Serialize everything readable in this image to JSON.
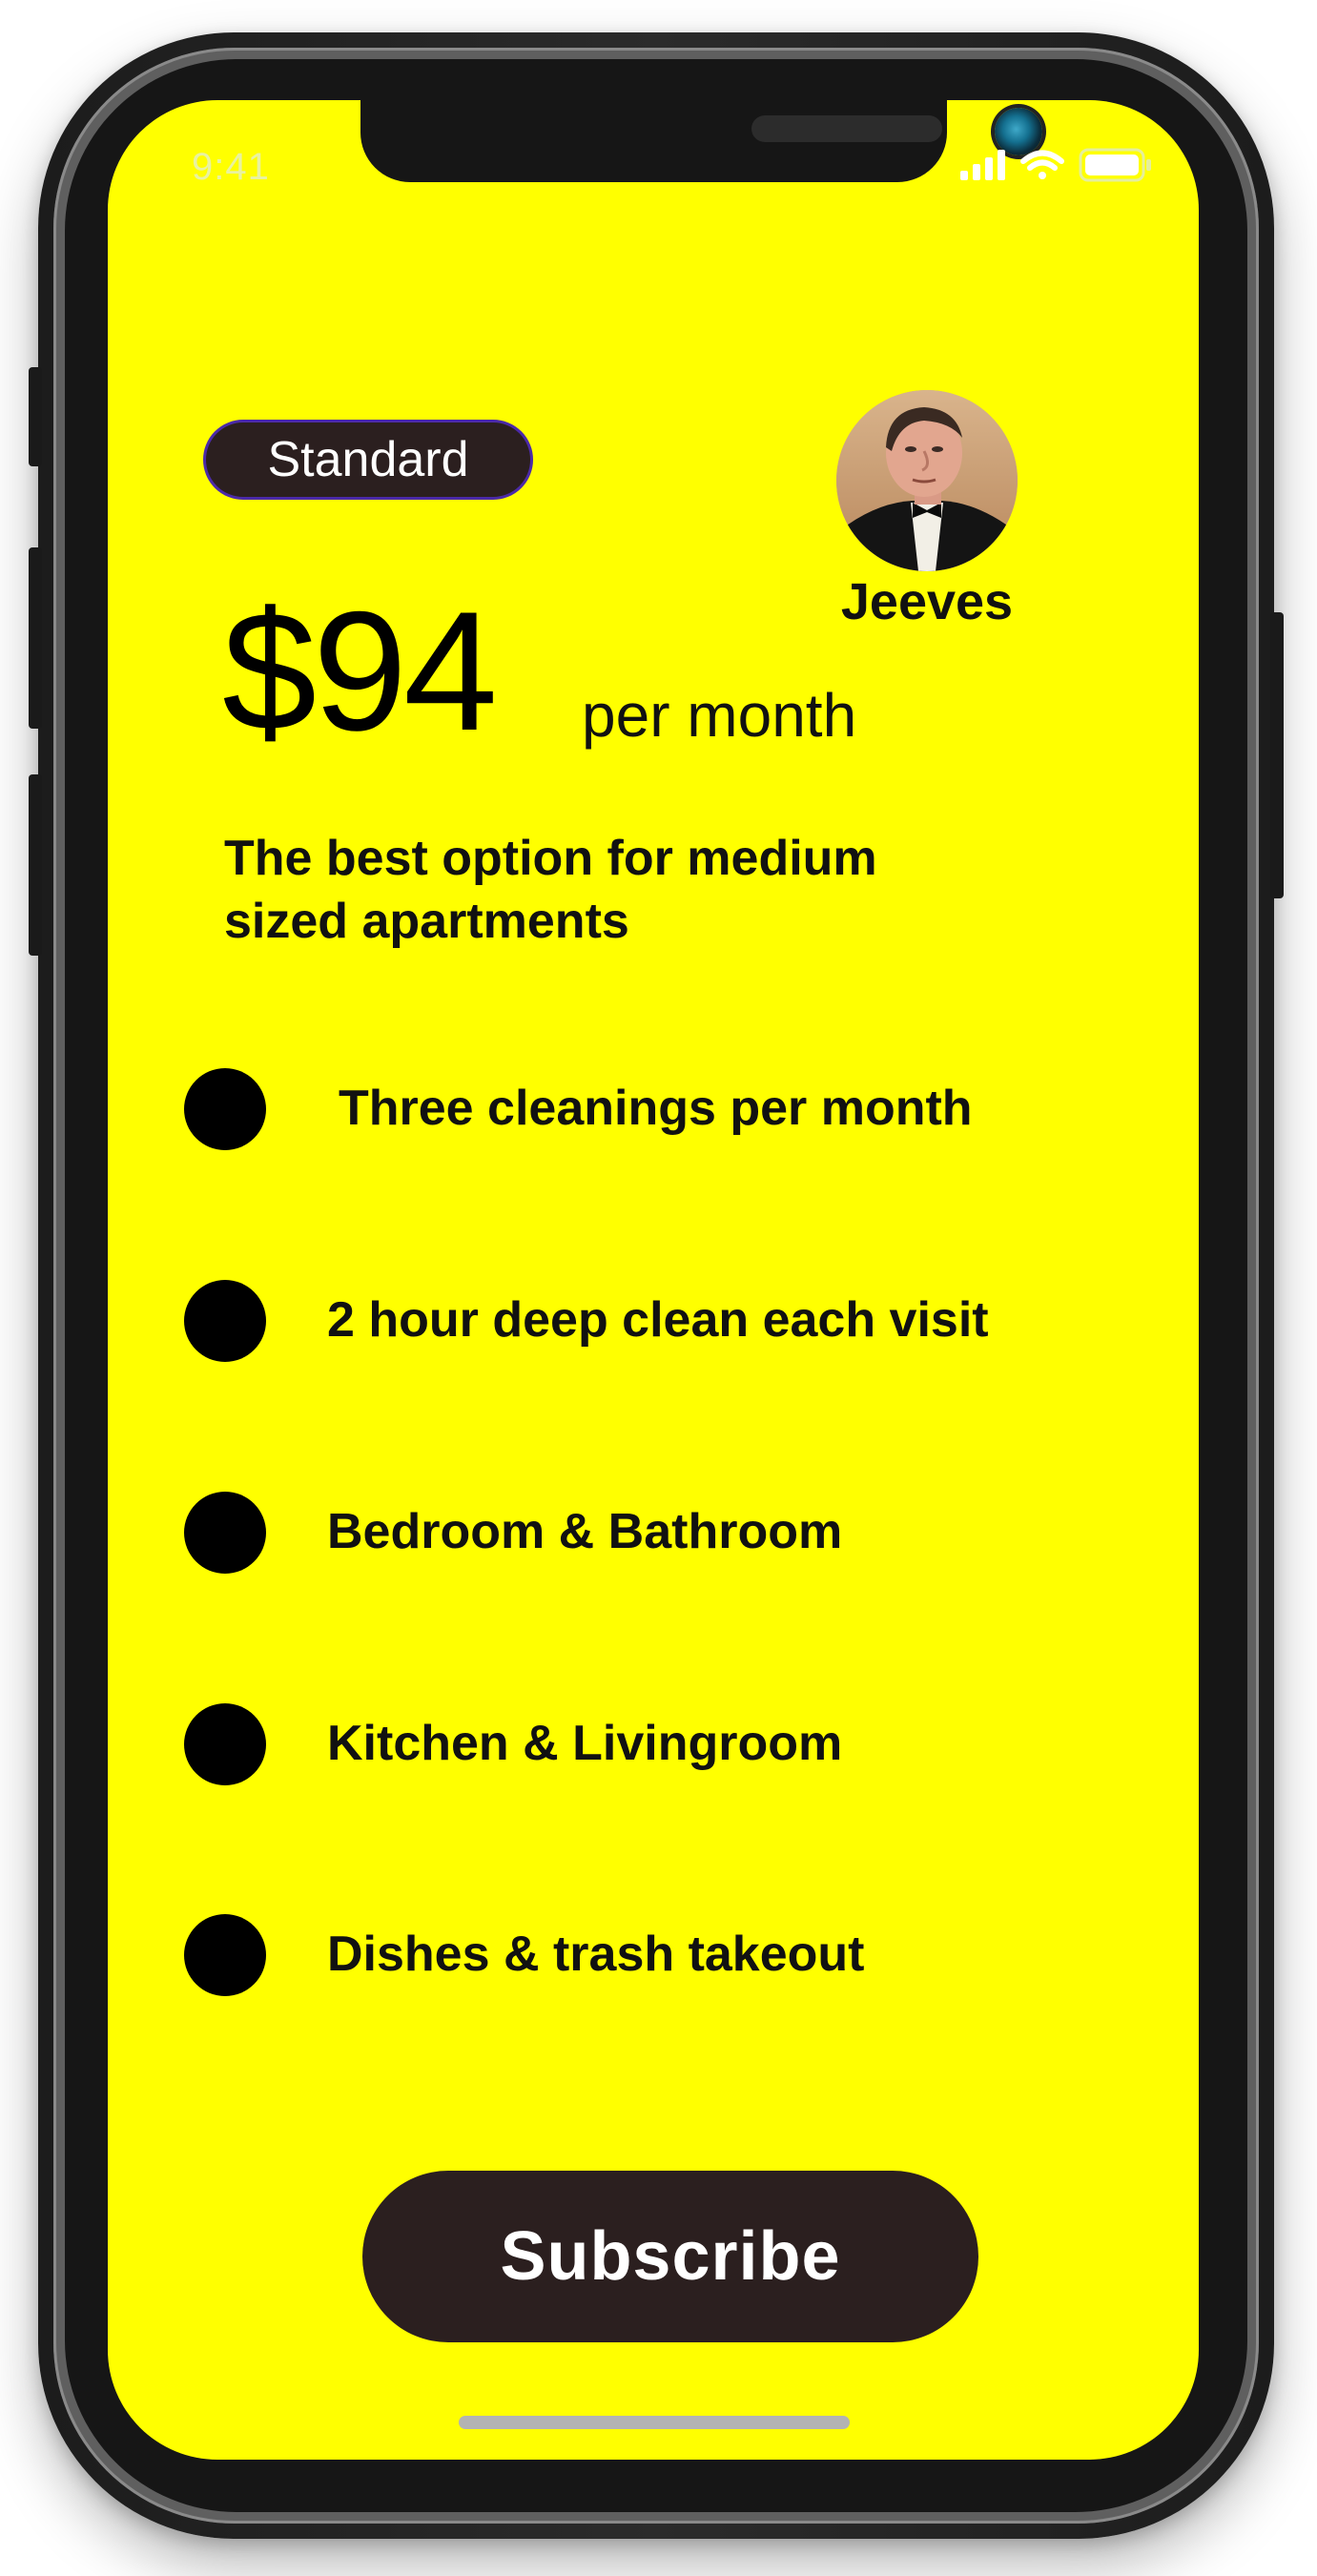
{
  "status_bar": {
    "time": "9:41",
    "icons": [
      "signal-icon",
      "wifi-icon",
      "battery-icon"
    ]
  },
  "plan": {
    "name": "Standard",
    "price": "$94",
    "period": "per month",
    "description": "The best option for medium sized apartments"
  },
  "mascot": {
    "name": "Jeeves"
  },
  "features": [
    {
      "label": "Three cleanings per month"
    },
    {
      "label": "2 hour deep clean each visit"
    },
    {
      "label": "Bedroom & Bathroom"
    },
    {
      "label": "Kitchen & Livingroom"
    },
    {
      "label": "Dishes & trash takeout"
    }
  ],
  "actions": {
    "subscribe_label": "Subscribe"
  },
  "colors": {
    "screen_background": "#ffff00",
    "button_background": "#2b1f1f",
    "button_text": "#ffffff",
    "badge_border": "#4b2aa8",
    "text": "#111111"
  }
}
